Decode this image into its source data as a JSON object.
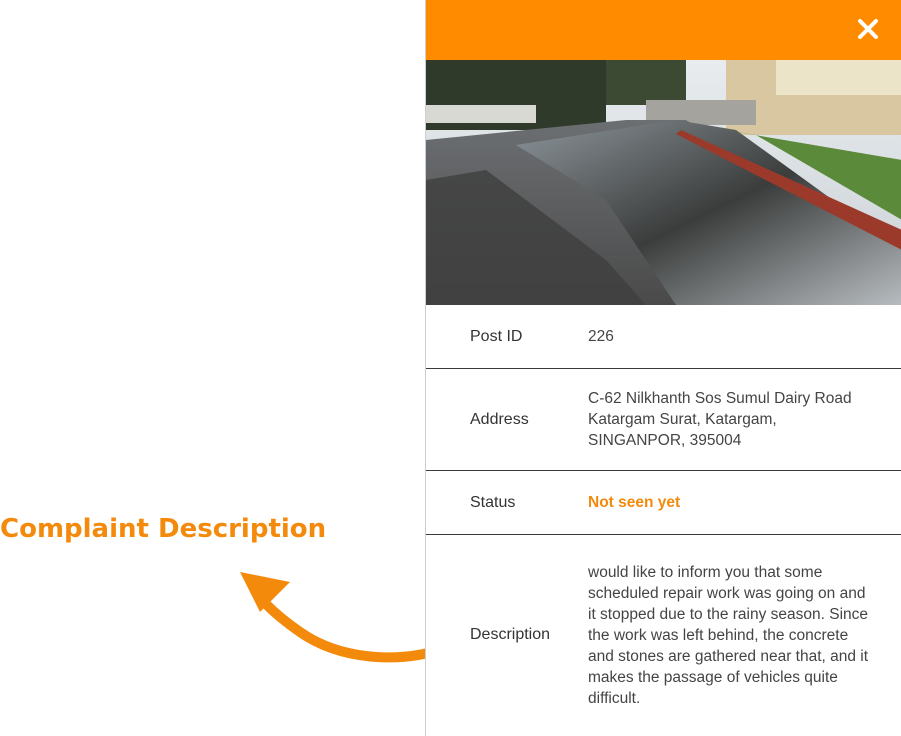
{
  "annotation": {
    "title": "Complaint Description"
  },
  "header": {
    "close_icon": "close-icon",
    "color": "#ff8c00"
  },
  "details": {
    "post_id_label": "Post ID",
    "post_id_value": "226",
    "address_label": "Address",
    "address_value": "C-62 Nilkhanth Sos Sumul Dairy Road Katargam Surat, Katargam, SINGANPOR, 395004",
    "status_label": "Status",
    "status_value": "Not seen yet",
    "status_color": "#f48a0c",
    "description_label": "Description",
    "description_value": "would like to inform you that some scheduled repair work was going on and it stopped due to the rainy season. Since the work was left behind, the concrete and stones are gathered near that, and it makes the passage of vehicles quite difficult."
  }
}
